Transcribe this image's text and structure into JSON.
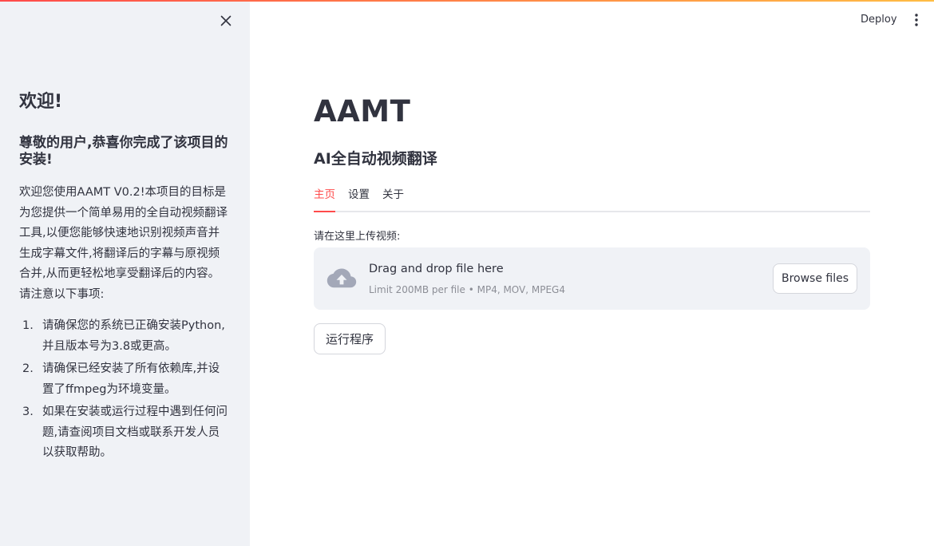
{
  "header": {
    "deploy_label": "Deploy",
    "menu_icon": "kebab-menu-icon"
  },
  "sidebar": {
    "close_icon": "close-icon",
    "welcome_title": "欢迎!",
    "congrats_heading": "尊敬的用户,恭喜你完成了该项目的安装!",
    "intro_paragraph": "欢迎您使用AAMT V0.2!本项目的目标是为您提供一个简单易用的全自动视频翻译工具,以便您能够快速地识别视频声音并生成字幕文件,将翻译后的字幕与原视频合并,从而更轻松地享受翻译后的内容。 请注意以下事项:",
    "notes": [
      {
        "number": "1.",
        "text": "请确保您的系统已正确安装Python,并且版本号为3.8或更高。"
      },
      {
        "number": "2.",
        "text": "请确保已经安装了所有依赖库,并设置了ffmpeg为环境变量。"
      },
      {
        "number": "3.",
        "text": "如果在安装或运行过程中遇到任何问题,请查阅项目文档或联系开发人员以获取帮助。"
      }
    ]
  },
  "main": {
    "title": "AAMT",
    "subtitle": "AI全自动视频翻译",
    "tabs": [
      {
        "label": "主页",
        "active": true
      },
      {
        "label": "设置",
        "active": false
      },
      {
        "label": "关于",
        "active": false
      }
    ],
    "uploader": {
      "label": "请在这里上传视频:",
      "drag_text": "Drag and drop file here",
      "limit_text": "Limit 200MB per file • MP4, MOV, MPEG4",
      "browse_label": "Browse files",
      "icon": "cloud-upload-icon"
    },
    "run_button_label": "运行程序"
  },
  "colors": {
    "accent": "#ff4b4b",
    "sidebar_bg": "#f0f2f6",
    "text": "#31333f",
    "muted_text": "#8c8e96"
  }
}
